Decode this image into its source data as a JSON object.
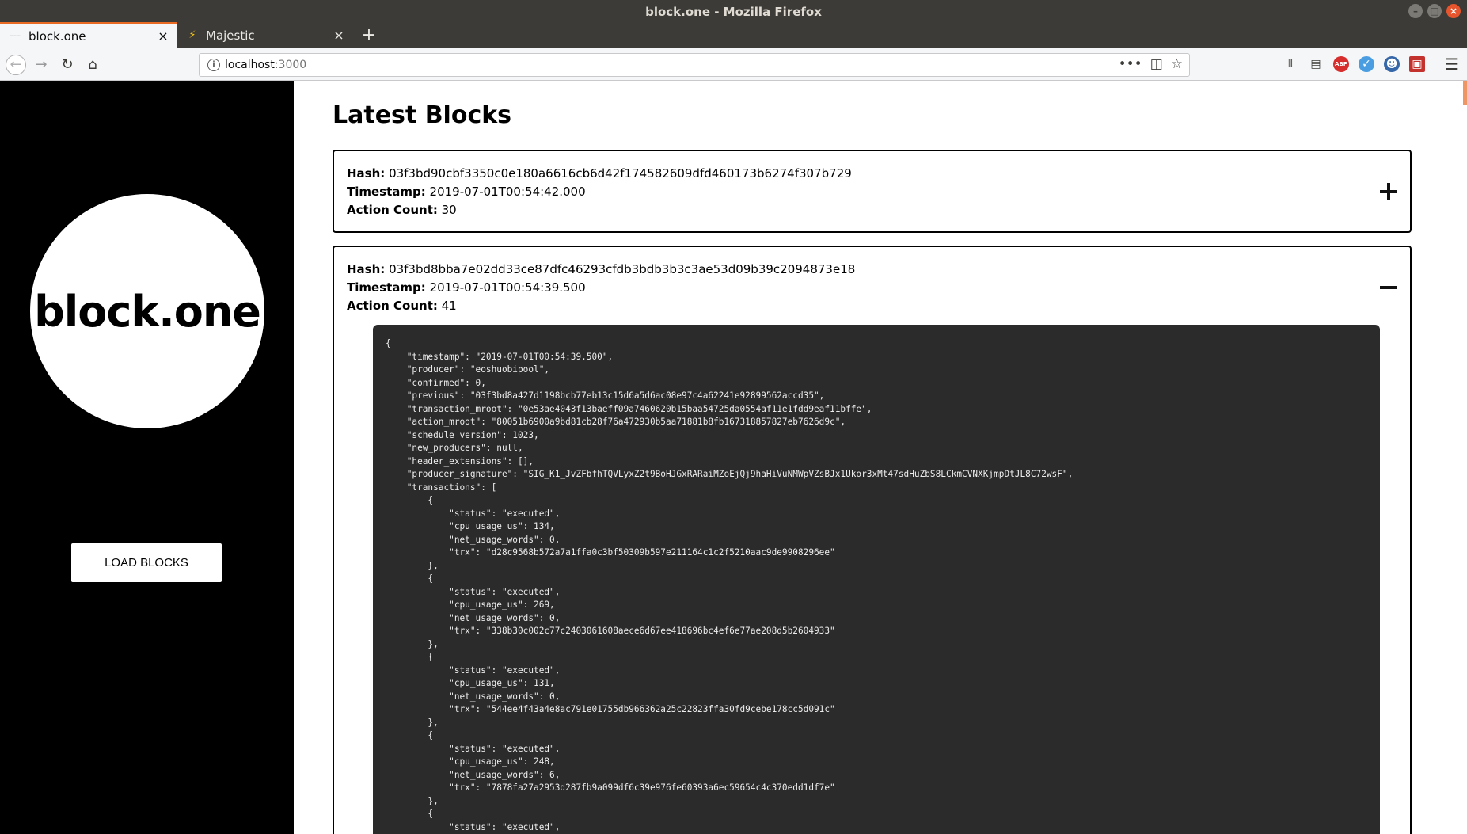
{
  "window": {
    "title": "block.one - Mozilla Firefox",
    "controls": {
      "minimize": "–",
      "maximize": "□",
      "close": "×"
    }
  },
  "tabs": [
    {
      "label": "block.one",
      "icon": "---",
      "close": "×"
    },
    {
      "label": "Majestic",
      "icon": "⚡",
      "close": "×"
    }
  ],
  "new_tab_label": "+",
  "navbar": {
    "back": "←",
    "forward": "→",
    "reload": "↻",
    "home": "⌂",
    "url_host": "localhost",
    "url_port": ":3000",
    "info": "i",
    "page_actions": "•••",
    "pocket": "◫",
    "bookmark": "☆",
    "right_icons": {
      "library": "⫴",
      "sidebar": "▤",
      "abp": "ABP",
      "ext_blue": "✓",
      "ext_ghost": "☻",
      "ext_red": "▣"
    },
    "menu": "☰"
  },
  "sidebar": {
    "logo_text": "block.one",
    "load_button_label": "LOAD BLOCKS"
  },
  "main": {
    "page_title": "Latest Blocks",
    "field_labels": {
      "hash": "Hash:",
      "timestamp": "Timestamp:",
      "action_count": "Action Count:"
    },
    "blocks": [
      {
        "hash": "03f3bd90cbf3350c0e180a6616cb6d42f174582609dfd460173b6274f307b729",
        "timestamp": "2019-07-01T00:54:42.000",
        "action_count": "30",
        "expanded": false
      },
      {
        "hash": "03f3bd8bba7e02dd33ce87dfc46293cfdb3bdb3b3c3ae53d09b39c2094873e18",
        "timestamp": "2019-07-01T00:54:39.500",
        "action_count": "41",
        "expanded": true,
        "raw_json": "{\n    \"timestamp\": \"2019-07-01T00:54:39.500\",\n    \"producer\": \"eoshuobipool\",\n    \"confirmed\": 0,\n    \"previous\": \"03f3bd8a427d1198bcb77eb13c15d6a5d6ac08e97c4a62241e92899562accd35\",\n    \"transaction_mroot\": \"0e53ae4043f13baeff09a7460620b15baa54725da0554af11e1fdd9eaf11bffe\",\n    \"action_mroot\": \"80051b6900a9bd81cb28f76a472930b5aa71881b8fb167318857827eb7626d9c\",\n    \"schedule_version\": 1023,\n    \"new_producers\": null,\n    \"header_extensions\": [],\n    \"producer_signature\": \"SIG_K1_JvZFbfhTQVLyxZ2t9BoHJGxRARaiMZoEjQj9haHiVuNMWpVZsBJx1Ukor3xMt47sdHuZbS8LCkmCVNXKjmpDtJL8C72wsF\",\n    \"transactions\": [\n        {\n            \"status\": \"executed\",\n            \"cpu_usage_us\": 134,\n            \"net_usage_words\": 0,\n            \"trx\": \"d28c9568b572a7a1ffa0c3bf50309b597e211164c1c2f5210aac9de9908296ee\"\n        },\n        {\n            \"status\": \"executed\",\n            \"cpu_usage_us\": 269,\n            \"net_usage_words\": 0,\n            \"trx\": \"338b30c002c77c2403061608aece6d67ee418696bc4ef6e77ae208d5b2604933\"\n        },\n        {\n            \"status\": \"executed\",\n            \"cpu_usage_us\": 131,\n            \"net_usage_words\": 0,\n            \"trx\": \"544ee4f43a4e8ac791e01755db966362a25c22823ffa30fd9cebe178cc5d091c\"\n        },\n        {\n            \"status\": \"executed\",\n            \"cpu_usage_us\": 248,\n            \"net_usage_words\": 6,\n            \"trx\": \"7878fa27a2953d287fb9a099df6c39e976fe60393a6ec59654c4c370edd1df7e\"\n        },\n        {\n            \"status\": \"executed\","
      }
    ]
  }
}
